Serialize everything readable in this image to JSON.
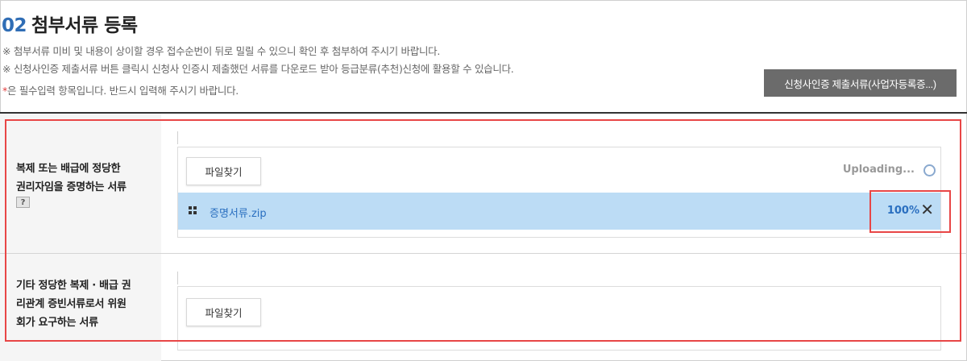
{
  "section": {
    "number": "02",
    "title": "첨부서류 등록"
  },
  "notes": {
    "line1": "※ 첨부서류 미비 및 내용이 상이할 경우 접수순번이 뒤로 밀릴 수 있으니 확인 후 첨부하여 주시기 바랍니다.",
    "line2": "※ 신청사인증 제출서류 버튼 클릭시 신청사 인증시 제출했던 서류를 다운로드 받아 등급분류(추천)신청에 활용할 수 있습니다.",
    "required_mark": "*",
    "required_text": "은 필수입력 항목입니다. 반드시 입력해 주시기 바랍니다."
  },
  "cert_docs_button": "신청사인증 제출서류(사업자등록증...)",
  "rows": [
    {
      "label_line1": "복제 또는 배급에 정당한",
      "label_line2": "권리자임을 증명하는 서류",
      "help": "?",
      "file_button": "파일찾기",
      "status": "Uploading...",
      "file": {
        "name": "증명서류.zip",
        "progress": "100%",
        "remove": "✕"
      }
    },
    {
      "label_line1": "기타 정당한 복제 · 배급 권",
      "label_line2": "리관계 증빈서류로서 위원",
      "label_line3": "회가 요구하는 서류",
      "file_button": "파일찾기"
    }
  ],
  "colors": {
    "accent": "#2f6db5",
    "highlight": "#e84646",
    "file_row_bg": "#bcdcf5",
    "button_dark": "#6b6b6b"
  }
}
